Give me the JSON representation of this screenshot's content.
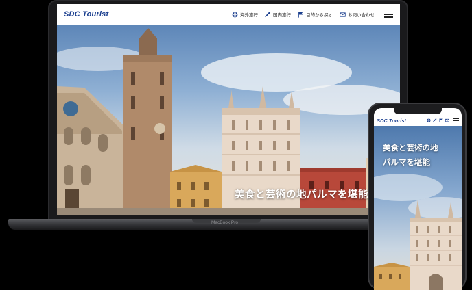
{
  "site": {
    "logo": "SDC Tourist",
    "nav": [
      {
        "label": "海外旅行",
        "icon": "globe-icon"
      },
      {
        "label": "国内旅行",
        "icon": "japan-map-icon"
      },
      {
        "label": "目的から探す",
        "icon": "flag-icon"
      },
      {
        "label": "お問い合わせ",
        "icon": "mail-icon"
      }
    ],
    "menu_icon": "hamburger-menu-icon",
    "hero_caption": "美食と芸術の地パルマを堪能"
  },
  "phone": {
    "caption_line1": "美食と芸術の地",
    "caption_line2": "パルマを堪能"
  },
  "laptop": {
    "model_label": "MacBook Pro"
  },
  "colors": {
    "brand": "#1b3f8f",
    "sky": "#7fa6d0",
    "stone": "#e8ddcf"
  }
}
